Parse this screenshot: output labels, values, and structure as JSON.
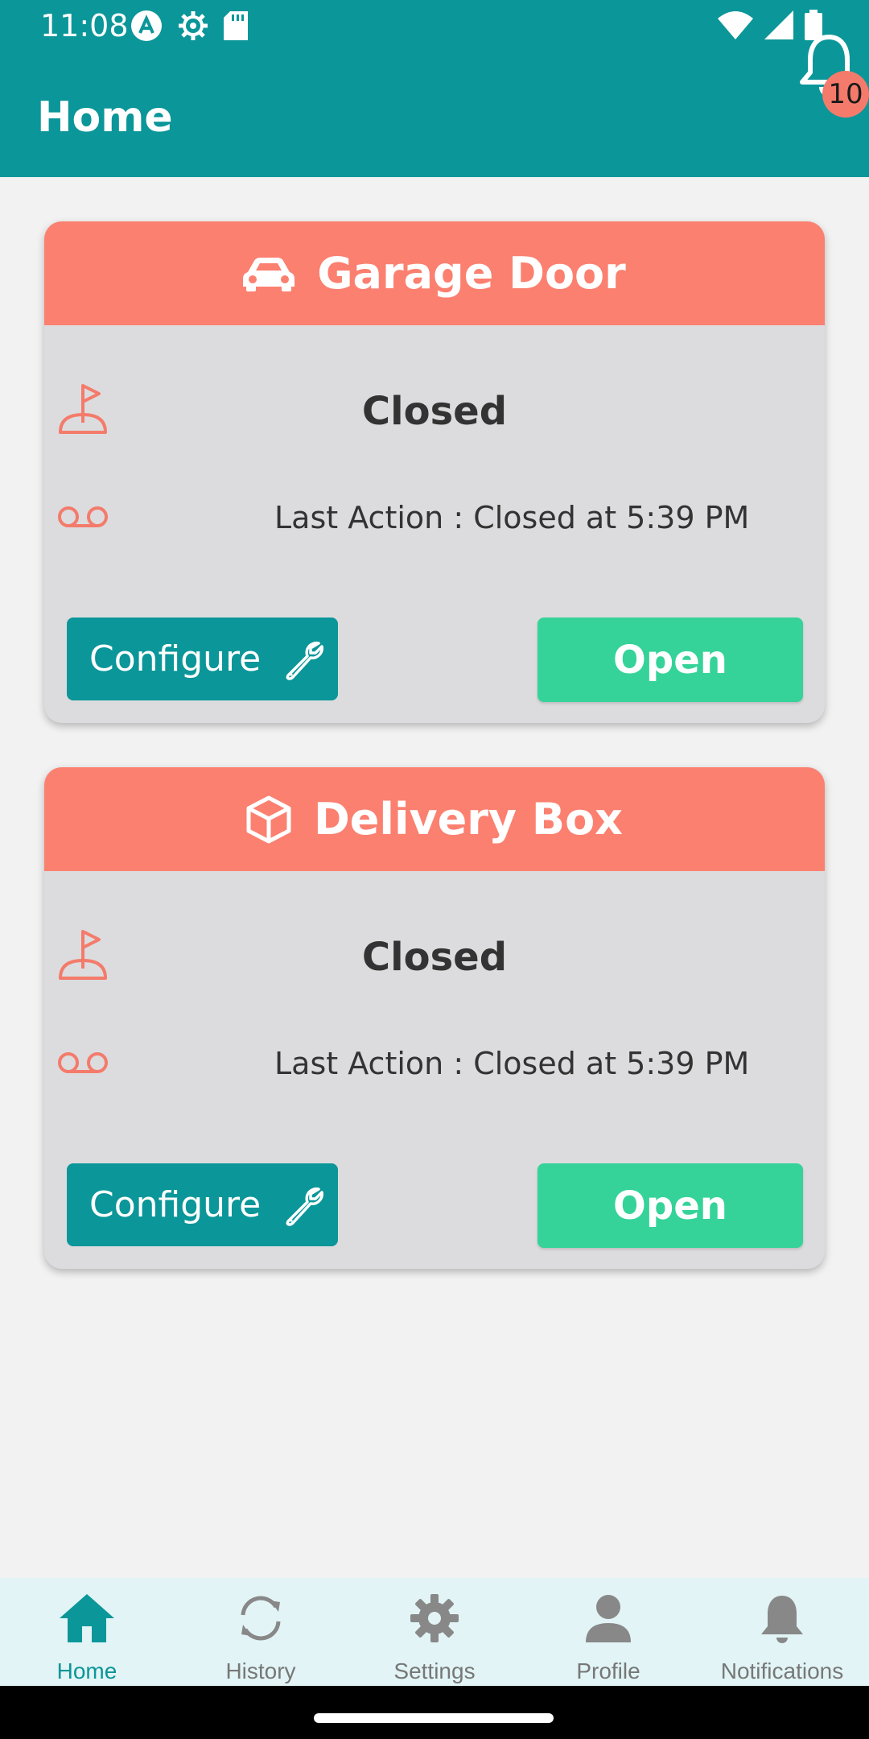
{
  "status_bar": {
    "time": "11:08",
    "left_icons": [
      "a-badge-icon",
      "gear-icon",
      "sd-card-icon"
    ],
    "right_icons": [
      "wifi-icon",
      "signal-icon",
      "battery-icon"
    ]
  },
  "app_bar": {
    "title": "Home",
    "notification_count": "10"
  },
  "colors": {
    "primary": "#0b9699",
    "card_header": "#fb8070",
    "open_button": "#35d399",
    "icon_accent": "#f47b6b"
  },
  "cards": [
    {
      "icon": "car-icon",
      "title": "Garage Door",
      "state": "Closed",
      "last_action": "Last Action : Closed at 5:39 PM",
      "configure_label": "Configure",
      "open_label": "Open"
    },
    {
      "icon": "box-icon",
      "title": "Delivery Box",
      "state": "Closed",
      "last_action": "Last Action : Closed at 5:39 PM",
      "configure_label": "Configure",
      "open_label": "Open"
    }
  ],
  "bottom_nav": {
    "active": "Home",
    "items": [
      {
        "label": "Home",
        "icon": "home-icon"
      },
      {
        "label": "History",
        "icon": "refresh-icon"
      },
      {
        "label": "Settings",
        "icon": "gear-icon"
      },
      {
        "label": "Profile",
        "icon": "person-icon"
      },
      {
        "label": "Notifications",
        "icon": "bell-icon"
      }
    ]
  }
}
